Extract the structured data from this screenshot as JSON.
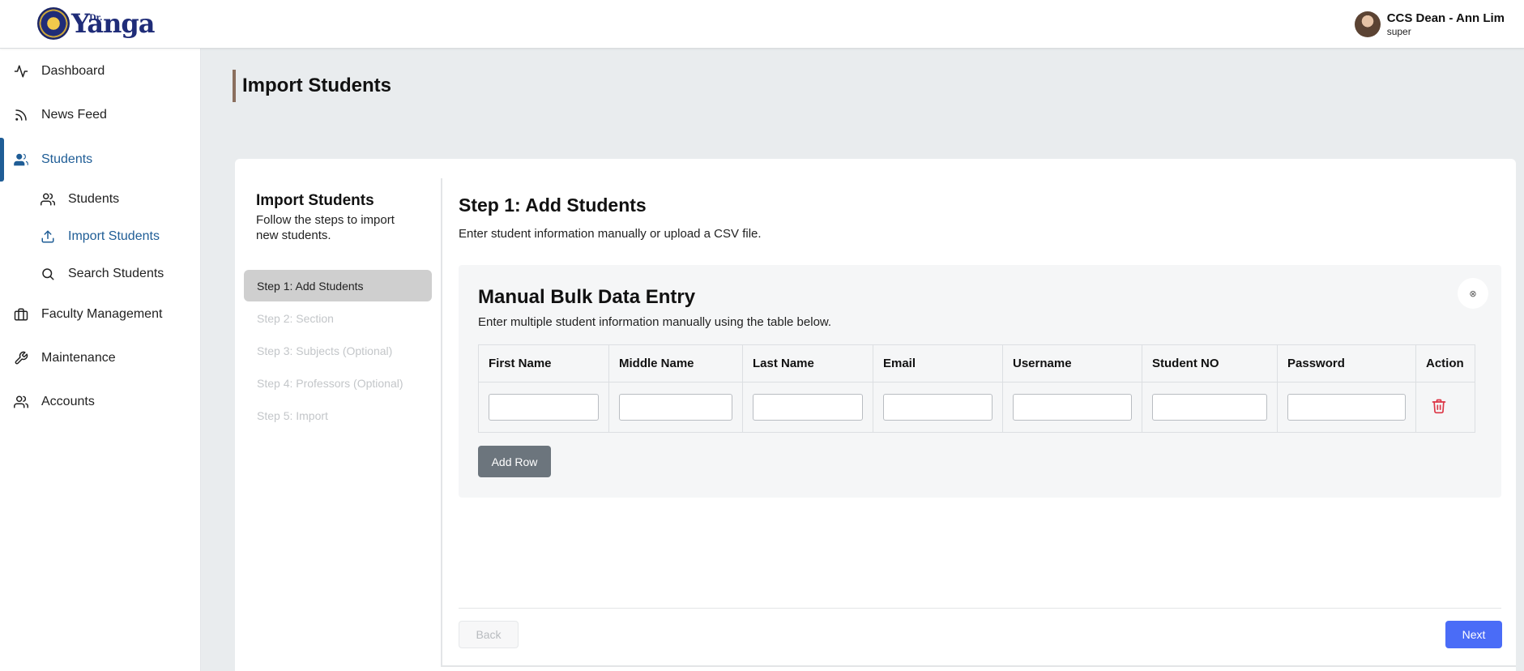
{
  "header": {
    "logo_text": "Yanga",
    "logo_prefix": "Dr.",
    "user_name": "CCS Dean - Ann Lim",
    "user_role": "super"
  },
  "sidebar": {
    "items": [
      {
        "label": "Dashboard",
        "icon": "activity-icon"
      },
      {
        "label": "News Feed",
        "icon": "rss-icon"
      },
      {
        "label": "Students",
        "icon": "users-icon",
        "active": true
      },
      {
        "label": "Faculty Management",
        "icon": "briefcase-icon"
      },
      {
        "label": "Maintenance",
        "icon": "wrench-icon"
      },
      {
        "label": "Accounts",
        "icon": "users-icon"
      }
    ],
    "sub_items": [
      {
        "label": "Students",
        "icon": "users-icon"
      },
      {
        "label": "Import Students",
        "icon": "upload-icon",
        "active": true
      },
      {
        "label": "Search Students",
        "icon": "search-icon"
      }
    ]
  },
  "page": {
    "title": "Import Students"
  },
  "wizard": {
    "title": "Import Students",
    "description": "Follow the steps to import new students.",
    "steps": [
      "Step 1: Add Students",
      "Step 2: Section",
      "Step 3: Subjects (Optional)",
      "Step 4: Professors (Optional)",
      "Step 5: Import"
    ],
    "active_step": 1
  },
  "content": {
    "title": "Step 1: Add Students",
    "description": "Enter student information manually or upload a CSV file.",
    "manual": {
      "title": "Manual Bulk Data Entry",
      "description": "Enter multiple student information manually using the table below.",
      "close_symbol": "⊗"
    },
    "columns": [
      "First Name",
      "Middle Name",
      "Last Name",
      "Email",
      "Username",
      "Student NO",
      "Password",
      "Action"
    ],
    "rows": [
      {
        "first_name": "",
        "middle_name": "",
        "last_name": "",
        "email": "",
        "username": "",
        "student_no": "",
        "password": ""
      }
    ],
    "add_row_label": "Add Row",
    "back_label": "Back",
    "next_label": "Next"
  },
  "colors": {
    "accent": "#1f5d96",
    "next_button": "#4a6cf7",
    "add_row_button": "#6c757d",
    "delete_icon": "#dc3545",
    "title_bar": "#8b6f5e"
  }
}
